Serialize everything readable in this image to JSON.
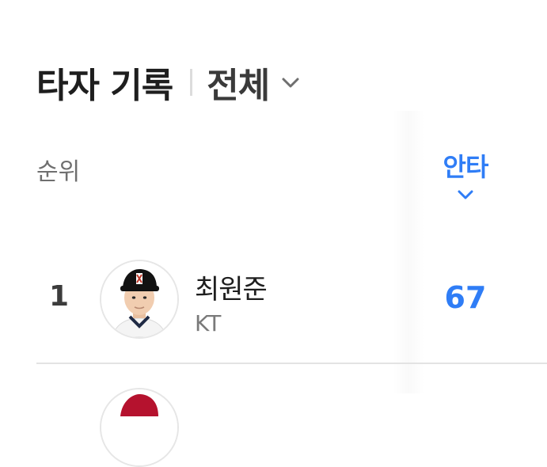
{
  "header": {
    "title": "타자 기록",
    "filter_label": "전체"
  },
  "table": {
    "rank_header": "순위",
    "stat_header": "안타",
    "sort_icon": "chevron-down-icon",
    "accent_color": "#2f7df6",
    "rows": [
      {
        "rank": "1",
        "player_name": "최원준",
        "team": "KT",
        "stat_value": "67",
        "avatar_icon": "player-photo"
      }
    ]
  }
}
